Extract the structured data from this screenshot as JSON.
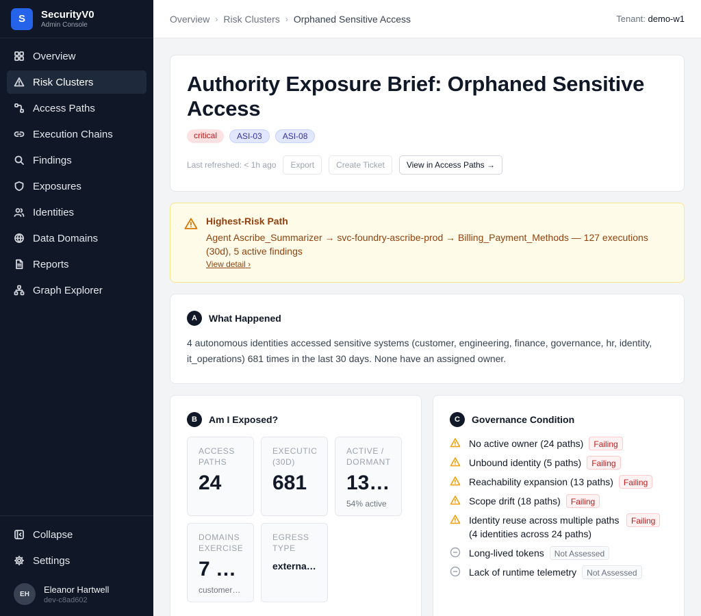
{
  "app": {
    "logo_letter": "S",
    "name": "SecurityV0",
    "subtitle": "Admin Console"
  },
  "nav": [
    {
      "label": "Overview",
      "icon": "grid-icon"
    },
    {
      "label": "Risk Clusters",
      "icon": "warning-triangle-icon",
      "active": true
    },
    {
      "label": "Access Paths",
      "icon": "route-icon"
    },
    {
      "label": "Execution Chains",
      "icon": "link-icon"
    },
    {
      "label": "Findings",
      "icon": "search-icon"
    },
    {
      "label": "Exposures",
      "icon": "shield-icon"
    },
    {
      "label": "Identities",
      "icon": "users-icon"
    },
    {
      "label": "Data Domains",
      "icon": "globe-icon"
    },
    {
      "label": "Reports",
      "icon": "document-icon"
    },
    {
      "label": "Graph Explorer",
      "icon": "network-icon"
    }
  ],
  "sidebar_bottom": {
    "collapse": "Collapse",
    "settings": "Settings"
  },
  "user": {
    "initials": "EH",
    "name": "Eleanor Hartwell",
    "id": "dev-c8ad602"
  },
  "breadcrumb": {
    "overview": "Overview",
    "risk_clusters": "Risk Clusters",
    "current": "Orphaned Sensitive Access"
  },
  "tenant": {
    "label": "Tenant:",
    "value": "demo-w1"
  },
  "hero": {
    "title": "Authority Exposure Brief: Orphaned Sensitive Access",
    "tags": {
      "severity": "critical",
      "asi1": "ASI-03",
      "asi2": "ASI-08"
    },
    "refreshed": "Last refreshed: < 1h ago",
    "export": "Export",
    "create_ticket": "Create Ticket",
    "view_access_paths": "View in Access Paths →"
  },
  "alert": {
    "title": "Highest-Risk Path",
    "body": "Agent Ascribe_Summarizer → svc-foundry-ascribe-prod → Billing_Payment_Methods — 127 executions (30d), 5 active findings",
    "link": "View detail"
  },
  "what_happened": {
    "badge": "A",
    "title": "What Happened",
    "text": "4 autonomous identities accessed sensitive systems (customer, engineering, finance, governance, hr, identity, it_operations) 681 times in the last 30 days. None have an assigned owner."
  },
  "exposed": {
    "badge": "B",
    "title": "Am I Exposed?",
    "metrics": {
      "access_paths": {
        "label1": "ACCESS",
        "label2": "PATHS",
        "value": "24"
      },
      "executions": {
        "label1": "EXECUTIO",
        "label2": "(30D)",
        "value": "681"
      },
      "active": {
        "label1": "ACTIVE /",
        "label2": "DORMANT",
        "value": "13 …",
        "sub": "54% active"
      },
      "domains": {
        "label1": "DOMAINS",
        "label2": "EXERCISE",
        "value": "7 …",
        "sub": "customer…"
      },
      "egress": {
        "label1": "EGRESS",
        "label2": "TYPE",
        "value": "externa…"
      }
    }
  },
  "governance": {
    "badge": "C",
    "title": "Governance Condition",
    "items": [
      {
        "text": "No active owner (24 paths)",
        "status": "Failing"
      },
      {
        "text": "Unbound identity (5 paths)",
        "status": "Failing"
      },
      {
        "text": "Reachability expansion (13 paths)",
        "status": "Failing"
      },
      {
        "text": "Scope drift (18 paths)",
        "status": "Failing"
      },
      {
        "text": "Identity reuse across multiple paths (4 identities across 24 paths)",
        "status": "Failing"
      },
      {
        "text": "Long-lived tokens",
        "status": "Not Assessed"
      },
      {
        "text": "Lack of runtime telemetry",
        "status": "Not Assessed"
      }
    ]
  },
  "colors": {
    "accent": "#2563eb",
    "sidebar_bg": "#101828",
    "failing": "#b91c1c",
    "warning": "#f59e0b"
  }
}
